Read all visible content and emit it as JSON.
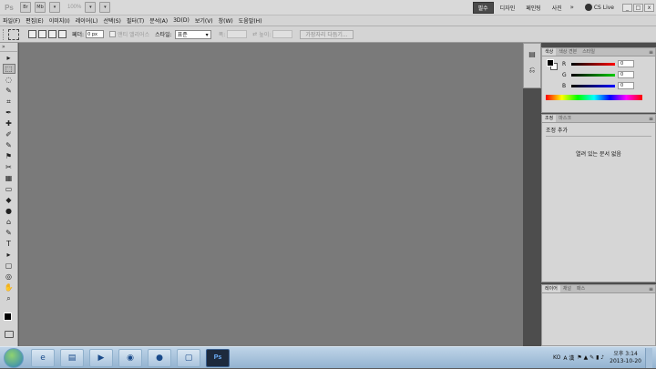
{
  "appbar": {
    "logo": "Ps",
    "zoom": "100%",
    "br_label": "Br",
    "mb_label": "Mb",
    "workspaces": [
      "필수",
      "디자인",
      "페인팅",
      "사진"
    ],
    "more": "»",
    "cslive": "CS Live",
    "window_controls": [
      "_",
      "□",
      "x"
    ]
  },
  "menu": [
    "파일(F)",
    "편집(E)",
    "이미지(I)",
    "레이어(L)",
    "선택(S)",
    "필터(T)",
    "분석(A)",
    "3D(D)",
    "보기(V)",
    "창(W)",
    "도움말(H)"
  ],
  "options": {
    "feather_label": "페더:",
    "feather_value": "0 px",
    "antialias": "앤티 앨리어스",
    "style_label": "스타일:",
    "style_value": "표준",
    "width_label": "폭:",
    "height_label": "높이:",
    "refine_button": "가장자리 다듬기..."
  },
  "tools": [
    "▸",
    "⬚",
    "◌",
    "✎",
    "⌗",
    "✒",
    "✚",
    "✐",
    "✎",
    "⚑",
    "✂",
    "▦",
    "▭",
    "◆",
    "●",
    "⌂",
    "✎",
    "T",
    "▸",
    "▢",
    "◎",
    "✋",
    "⌕"
  ],
  "panels": {
    "color_tabs": [
      "색상",
      "색상 견본",
      "스타일"
    ],
    "channels": [
      {
        "label": "R",
        "value": "0",
        "gradient": "#ff0000"
      },
      {
        "label": "G",
        "value": "0",
        "gradient": "#00cc00"
      },
      {
        "label": "B",
        "value": "0",
        "gradient": "#0000ff"
      }
    ],
    "adjust_tabs": [
      "조정",
      "마스크"
    ],
    "adjust_title": "조정 추가",
    "adjust_message": "열려 있는 문서 없음",
    "layer_tabs": [
      "레이어",
      "채널",
      "패스"
    ]
  },
  "taskbar": {
    "tray_lang": "KO",
    "tray_ime": "A 漢",
    "time": "오후 3:14",
    "date": "2013-10-20",
    "ps_label": "Ps"
  }
}
